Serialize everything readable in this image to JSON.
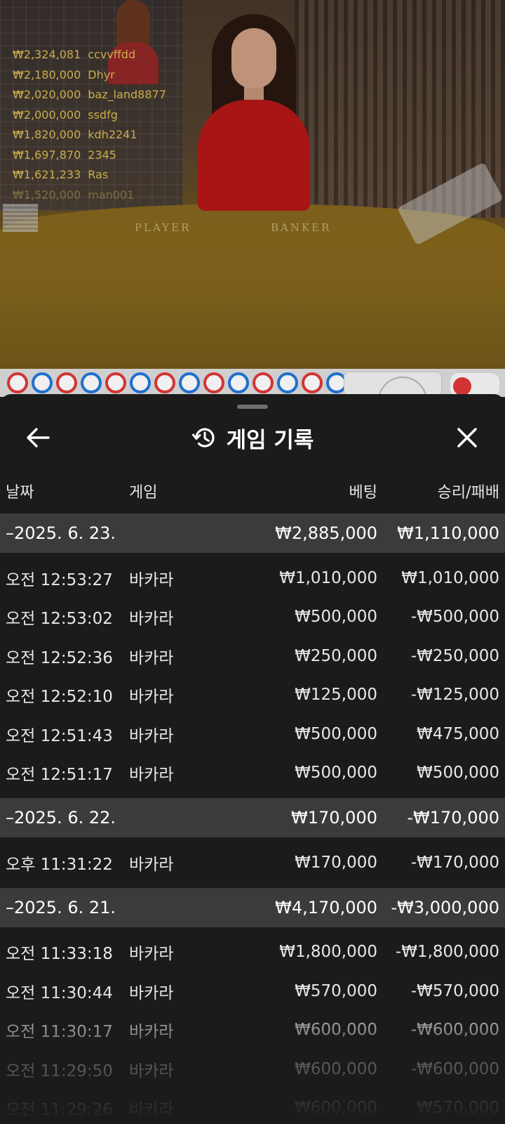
{
  "leaderboard": [
    {
      "amount": "₩2,324,081",
      "name": "ccvvffdd"
    },
    {
      "amount": "₩2,180,000",
      "name": "Dhyr"
    },
    {
      "amount": "₩2,020,000",
      "name": "baz_land8877"
    },
    {
      "amount": "₩2,000,000",
      "name": "ssdfg"
    },
    {
      "amount": "₩1,820,000",
      "name": "kdh2241"
    },
    {
      "amount": "₩1,697,870",
      "name": "2345"
    },
    {
      "amount": "₩1,621,233",
      "name": "Ras"
    },
    {
      "amount": "₩1,520,000",
      "name": "man001"
    }
  ],
  "table_labels": {
    "player": "PLAYER",
    "banker": "BANKER"
  },
  "bead_road": [
    "b",
    "p",
    "b",
    "p",
    "b",
    "p",
    "b",
    "p",
    "b",
    "p",
    "b",
    "p",
    "b",
    "p"
  ],
  "sheet": {
    "title": "게임 기록",
    "icons": {
      "back": "arrow-left-icon",
      "history": "history-icon",
      "close": "close-icon"
    },
    "columns": {
      "date": "날짜",
      "game": "게임",
      "bet": "베팅",
      "result": "승리/패배"
    }
  },
  "groups": [
    {
      "date": "–2025. 6. 23.",
      "bet": "₩2,885,000",
      "result": "₩1,110,000",
      "rows": [
        {
          "time": "오전 12:53:27",
          "game": "바카라",
          "bet": "₩1,010,000",
          "result": "₩1,010,000"
        },
        {
          "time": "오전 12:53:02",
          "game": "바카라",
          "bet": "₩500,000",
          "result": "-₩500,000"
        },
        {
          "time": "오전 12:52:36",
          "game": "바카라",
          "bet": "₩250,000",
          "result": "-₩250,000"
        },
        {
          "time": "오전 12:52:10",
          "game": "바카라",
          "bet": "₩125,000",
          "result": "-₩125,000"
        },
        {
          "time": "오전 12:51:43",
          "game": "바카라",
          "bet": "₩500,000",
          "result": "₩475,000"
        },
        {
          "time": "오전 12:51:17",
          "game": "바카라",
          "bet": "₩500,000",
          "result": "₩500,000"
        }
      ]
    },
    {
      "date": "–2025. 6. 22.",
      "bet": "₩170,000",
      "result": "-₩170,000",
      "rows": [
        {
          "time": "오후 11:31:22",
          "game": "바카라",
          "bet": "₩170,000",
          "result": "-₩170,000"
        }
      ]
    },
    {
      "date": "–2025. 6. 21.",
      "bet": "₩4,170,000",
      "result": "-₩3,000,000",
      "rows": [
        {
          "time": "오전 11:33:18",
          "game": "바카라",
          "bet": "₩1,800,000",
          "result": "-₩1,800,000"
        },
        {
          "time": "오전 11:30:44",
          "game": "바카라",
          "bet": "₩570,000",
          "result": "-₩570,000"
        },
        {
          "time": "오전 11:30:17",
          "game": "바카라",
          "bet": "₩600,000",
          "result": "-₩600,000"
        },
        {
          "time": "오전 11:29:50",
          "game": "바카라",
          "bet": "₩600,000",
          "result": "-₩600,000"
        },
        {
          "time": "오전 11:29:26",
          "game": "바카라",
          "bet": "₩600,000",
          "result": "₩570,000"
        }
      ]
    }
  ]
}
